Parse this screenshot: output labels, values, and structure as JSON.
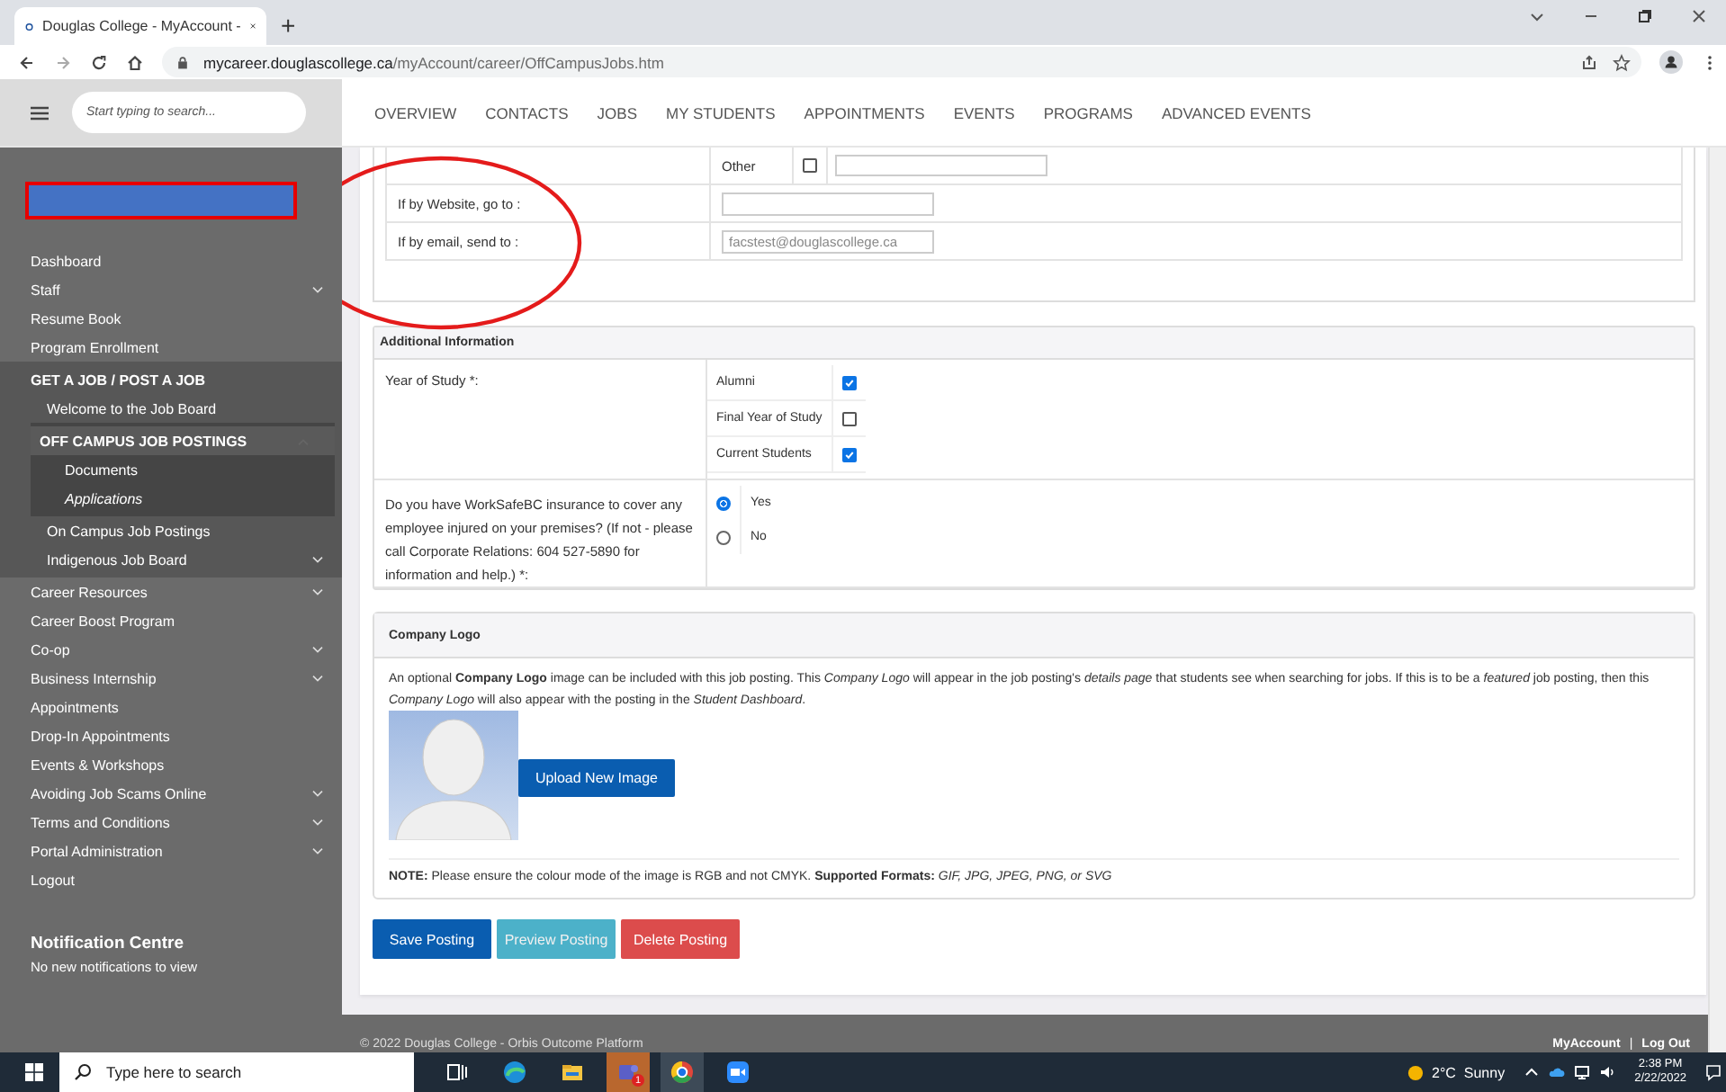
{
  "browser": {
    "tab_title": "Douglas College - MyAccount -",
    "new_tab": "+",
    "url_domain": "mycareer.douglascollege.ca",
    "url_path": "/myAccount/career/OffCampusJobs.htm"
  },
  "app_header": {
    "search_placeholder": "Start typing to search...",
    "nav": [
      {
        "label": "OVERVIEW"
      },
      {
        "label": "CONTACTS"
      },
      {
        "label": "JOBS"
      },
      {
        "label": "MY STUDENTS"
      },
      {
        "label": "APPOINTMENTS"
      },
      {
        "label": "EVENTS"
      },
      {
        "label": "PROGRAMS"
      },
      {
        "label": "ADVANCED EVENTS"
      }
    ]
  },
  "sidebar": {
    "items": [
      {
        "label": "Dashboard",
        "chevron": false
      },
      {
        "label": "Staff",
        "chevron": true
      },
      {
        "label": "Resume Book",
        "chevron": false
      },
      {
        "label": "Program Enrollment",
        "chevron": false
      },
      {
        "label": "GET A JOB / POST A JOB",
        "children": [
          {
            "label": "Welcome to the Job Board",
            "chevron": false,
            "selected": false
          },
          {
            "label": "OFF CAMPUS JOB POSTINGS",
            "chevron": true,
            "expanded": true,
            "selected": true,
            "children": [
              {
                "label": "Documents",
                "italic": false
              },
              {
                "label": "Applications",
                "italic": true
              }
            ]
          },
          {
            "label": "On Campus Job Postings",
            "chevron": false,
            "selected": false
          },
          {
            "label": "Indigenous Job Board",
            "chevron": true,
            "selected": false
          }
        ]
      },
      {
        "label": "Career Resources",
        "chevron": true
      },
      {
        "label": "Career Boost Program",
        "chevron": false
      },
      {
        "label": "Co-op",
        "chevron": true
      },
      {
        "label": "Business Internship",
        "chevron": true
      },
      {
        "label": "Appointments",
        "chevron": false
      },
      {
        "label": "Drop-In Appointments",
        "chevron": false
      },
      {
        "label": "Events & Workshops",
        "chevron": false
      },
      {
        "label": "Avoiding Job Scams Online",
        "chevron": true
      },
      {
        "label": "Terms and Conditions",
        "chevron": true
      },
      {
        "label": "Portal Administration",
        "chevron": true
      },
      {
        "label": "Logout",
        "chevron": false
      }
    ],
    "notification_title": "Notification Centre",
    "notification_text": "No new notifications to view"
  },
  "application_method": {
    "other_label": "Other",
    "other_checked": false,
    "rows": [
      {
        "label": "If by Website, go to :",
        "value": ""
      },
      {
        "label": "If by email, send to :",
        "value": "facstest@douglascollege.ca"
      }
    ]
  },
  "additional_information": {
    "title": "Additional Information",
    "year_label": "Year of Study *:",
    "year_options": [
      {
        "label": "Alumni",
        "checked": true
      },
      {
        "label": "Final Year of Study",
        "checked": false
      },
      {
        "label": "Current Students",
        "checked": true
      }
    ],
    "insurance_label": "Do you have WorkSafeBC insurance to cover any employee injured on your premises? (If not - please call Corporate Relations: 604 527-5890 for information and help.) *:",
    "insurance_options": [
      {
        "label": "Yes",
        "selected": true
      },
      {
        "label": "No",
        "selected": false
      }
    ]
  },
  "company_logo": {
    "title": "Company Logo",
    "description": "An optional **Company Logo** image can be included with this job posting. This *Company Logo* will appear in the job posting's *details page* that students see when searching for jobs. If this is to be a *featured* job posting, then this *Company Logo* will also appear with the posting in the *Student Dashboard*.",
    "upload_button": "Upload New Image",
    "note": "**NOTE:** Please ensure the colour mode of the image is RGB and not CMYK. **Supported Formats:** *GIF, JPG, JPEG, PNG, or SVG*"
  },
  "actions": [
    {
      "label": "Save Posting",
      "kind": "primary"
    },
    {
      "label": "Preview Posting",
      "kind": "info"
    },
    {
      "label": "Delete Posting",
      "kind": "danger"
    }
  ],
  "footer": {
    "copyright": "© 2022 Douglas College - Orbis Outcome Platform",
    "links": [
      "MyAccount",
      "Log Out"
    ],
    "separator": "|"
  },
  "taskbar": {
    "search_placeholder": "Type here to search",
    "teams_badge": "1",
    "weather": "2°C  Sunny",
    "time": "2:38 PM",
    "date": "2/22/2022"
  }
}
